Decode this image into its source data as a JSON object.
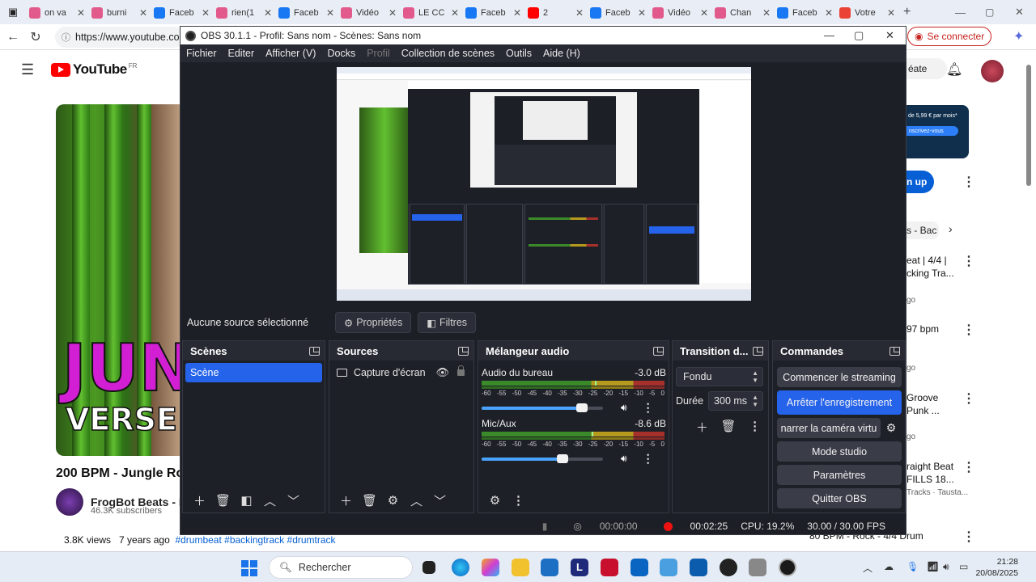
{
  "browser": {
    "tabs": [
      {
        "label": "on va",
        "color": "#e25a8b"
      },
      {
        "label": "burni",
        "color": "#e25a8b"
      },
      {
        "label": "Faceb",
        "color": "#1877f2"
      },
      {
        "label": "rien(1",
        "color": "#e25a8b"
      },
      {
        "label": "Faceb",
        "color": "#1877f2"
      },
      {
        "label": "Vidéo",
        "color": "#e25a8b"
      },
      {
        "label": "LE CC",
        "color": "#e25a8b"
      },
      {
        "label": "Faceb",
        "color": "#1877f2"
      },
      {
        "label": "2",
        "color": "#ff0000"
      },
      {
        "label": "Faceb",
        "color": "#1877f2"
      },
      {
        "label": "Vidéo",
        "color": "#e25a8b"
      },
      {
        "label": "Chan",
        "color": "#e25a8b"
      },
      {
        "label": "Faceb",
        "color": "#1877f2"
      },
      {
        "label": "Votre",
        "color": "#ea4335"
      }
    ],
    "url": "https://www.youtube.com",
    "signin": "Se connecter"
  },
  "youtube": {
    "logo_text": "YouTube",
    "region": "FR",
    "thumb_big": "JUN",
    "thumb_sub": "VERSE CH",
    "video_title": "200 BPM - Jungle Ro",
    "channel": "FrogBot Beats - Ba",
    "subscribers": "46.3K subscribers",
    "views": "3.8K views",
    "age": "7 years ago",
    "tags": "#drumbeat #backingtrack #drumtrack",
    "right_col": {
      "create": "éate",
      "promo_price": "de 5,99 € par mois*",
      "promo_cta": "nscrivez-vous",
      "signup": "n up",
      "filter": "s - Bac",
      "items": [
        {
          "title": "eat | 4/4 |",
          "line2": "cking Tra...",
          "sub": "go"
        },
        {
          "title": "97 bpm",
          "line2": "",
          "sub": "go"
        },
        {
          "title": "Groove",
          "line2": "Punk ...",
          "sub": "go"
        },
        {
          "title": "raight Beat",
          "line2": "FILLS 18...",
          "sub": "Tracks · Tausta..."
        },
        {
          "title": "80 BPM - Rock - 4/4 Drum",
          "line2": "",
          "sub": ""
        }
      ]
    }
  },
  "obs": {
    "title": "OBS 30.1.1 - Profil: Sans nom - Scènes: Sans nom",
    "menu": [
      "Fichier",
      "Editer",
      "Afficher (V)",
      "Docks",
      "Profil",
      "Collection de scènes",
      "Outils",
      "Aide (H)"
    ],
    "no_source": "Aucune source sélectionné",
    "properties": "Propriétés",
    "filters": "Filtres",
    "scenes": {
      "title": "Scènes",
      "items": [
        "Scène"
      ]
    },
    "sources": {
      "title": "Sources",
      "items": [
        "Capture d'écran"
      ]
    },
    "mixer": {
      "title": "Mélangeur audio",
      "scale": [
        "-60",
        "-55",
        "-50",
        "-45",
        "-40",
        "-35",
        "-30",
        "-25",
        "-20",
        "-15",
        "-10",
        "-5",
        "0"
      ],
      "channels": [
        {
          "name": "Audio du bureau",
          "db": "-3.0 dB",
          "volume": 0.92,
          "peak": 0.62
        },
        {
          "name": "Mic/Aux",
          "db": "-8.6 dB",
          "volume": 0.74,
          "peak": 0.6
        }
      ]
    },
    "transition": {
      "title": "Transition d...",
      "type": "Fondu",
      "duration_label": "Durée",
      "duration": "300 ms"
    },
    "commands": {
      "title": "Commandes",
      "buttons": [
        "Commencer le streaming",
        "Arrêter l'enregistrement",
        "narrer la caméra virtu",
        "Mode studio",
        "Paramètres",
        "Quitter OBS"
      ]
    },
    "status": {
      "stream_time": "00:00:00",
      "rec_time": "00:02:25",
      "cpu": "CPU: 19.2%",
      "fps": "30.00 / 30.00 FPS"
    }
  },
  "taskbar": {
    "search": "Rechercher",
    "time": "21:28",
    "date": "20/08/2025"
  }
}
